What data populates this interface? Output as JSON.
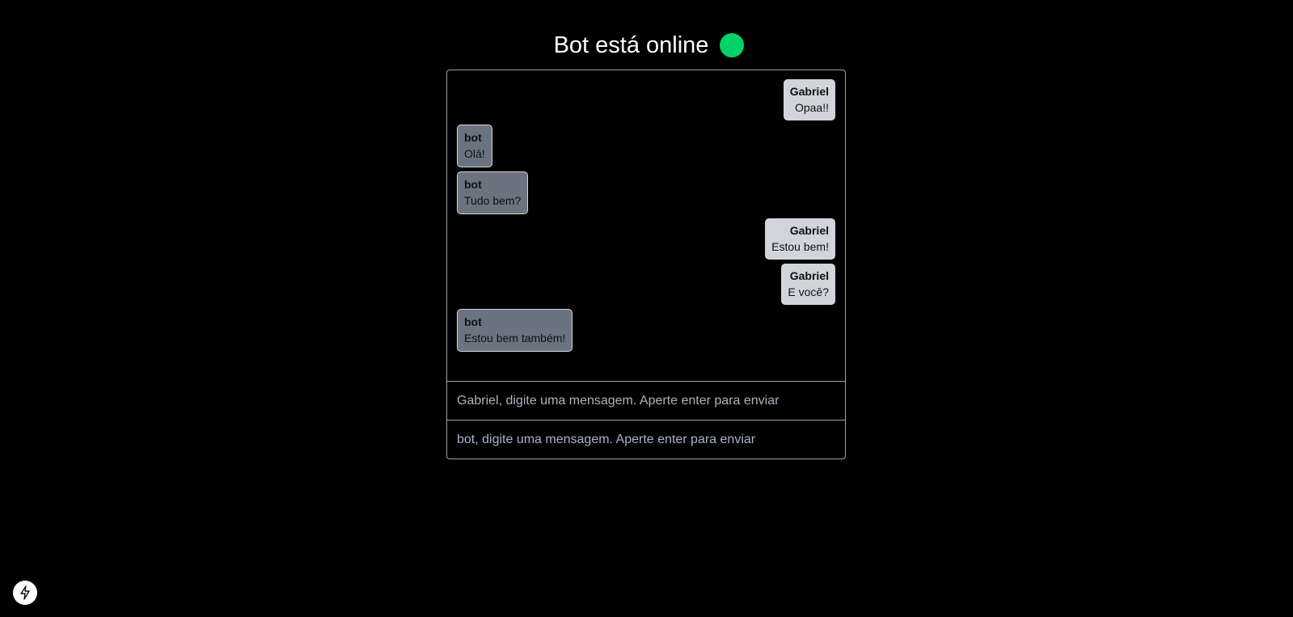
{
  "header": {
    "title": "Bot está online",
    "status_color": "#00d26a"
  },
  "messages": [
    {
      "author": "Gabriel",
      "text": "Opaa!!",
      "side": "user"
    },
    {
      "author": "bot",
      "text": "Olá!",
      "side": "bot"
    },
    {
      "author": "bot",
      "text": "Tudo bem?",
      "side": "bot"
    },
    {
      "author": "Gabriel",
      "text": "Estou bem!",
      "side": "user"
    },
    {
      "author": "Gabriel",
      "text": "E você?",
      "side": "user"
    },
    {
      "author": "bot",
      "text": "Estou bem também!",
      "side": "bot"
    }
  ],
  "inputs": {
    "gabriel_placeholder": "Gabriel, digite uma mensagem. Aperte enter para enviar",
    "bot_placeholder": "bot, digite uma mensagem. Aperte enter para enviar"
  },
  "colors": {
    "user_bubble": "#d1d5db",
    "bot_bubble": "#6b7280"
  },
  "icons": {
    "dev_indicator": "lightning-bolt-icon"
  }
}
